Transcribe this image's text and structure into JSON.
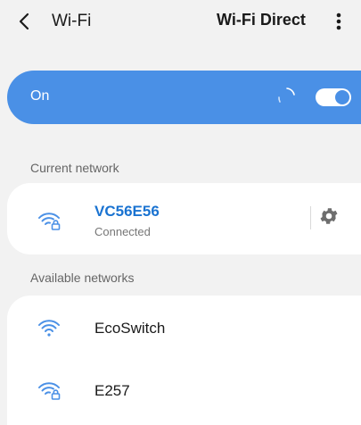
{
  "header": {
    "title": "Wi-Fi",
    "direct_label": "Wi-Fi Direct"
  },
  "toggle": {
    "label": "On",
    "state": true
  },
  "current": {
    "section_label": "Current network",
    "network": {
      "name": "VC56E56",
      "status": "Connected",
      "secured": true
    }
  },
  "available": {
    "section_label": "Available networks",
    "networks": [
      {
        "name": "EcoSwitch",
        "secured": false
      },
      {
        "name": "E257",
        "secured": true
      }
    ]
  },
  "colors": {
    "accent": "#4a90e6",
    "connected_text": "#1a73d1",
    "background": "#f2f2f2"
  },
  "icons": {
    "back": "chevron-left-icon",
    "menu": "more-vert-icon",
    "wifi": "wifi-icon",
    "wifi_lock": "wifi-lock-icon",
    "settings": "gear-icon"
  }
}
